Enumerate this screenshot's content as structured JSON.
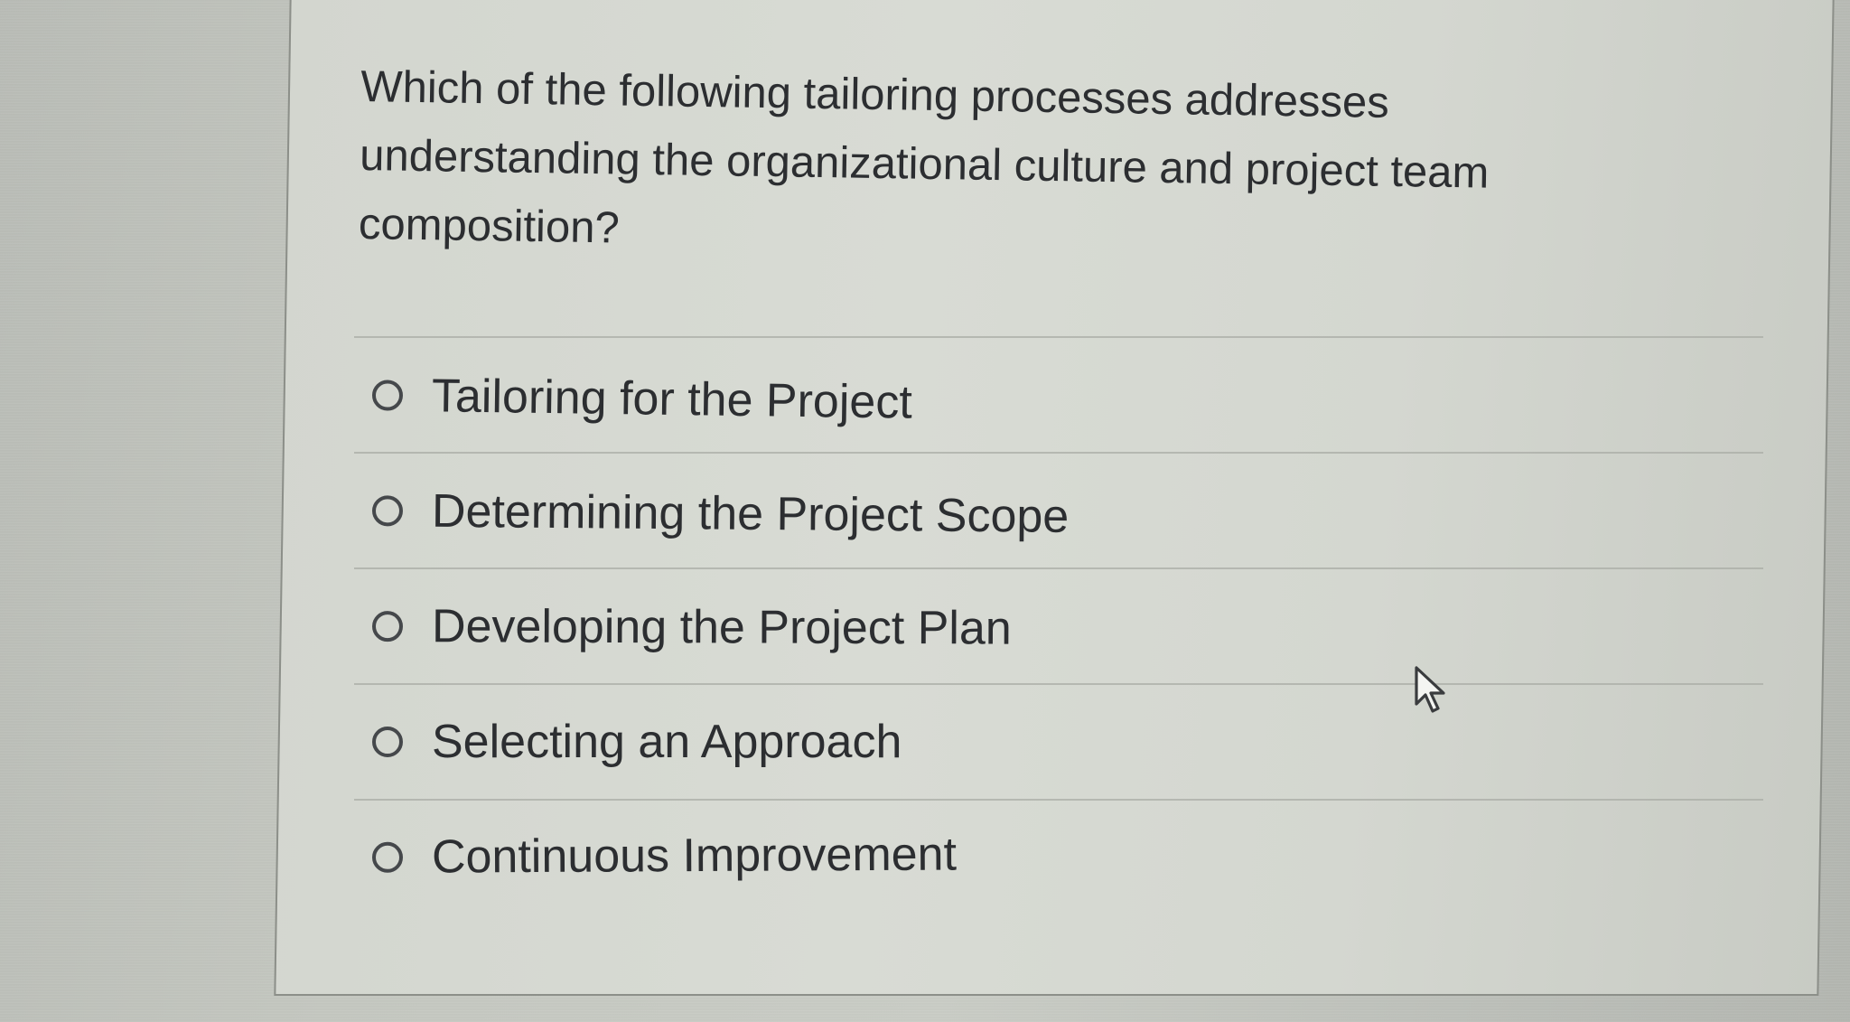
{
  "question": {
    "text": "Which of the following tailoring processes addresses understanding the organizational culture and project team composition?"
  },
  "options": [
    {
      "label": "Tailoring for the Project",
      "selected": false
    },
    {
      "label": "Determining the Project Scope",
      "selected": false
    },
    {
      "label": "Developing the Project Plan",
      "selected": false
    },
    {
      "label": "Selecting an Approach",
      "selected": false
    },
    {
      "label": "Continuous Improvement",
      "selected": false
    }
  ],
  "icons": {
    "option_radio": "radio-button-icon",
    "pointer": "mouse-pointer-icon"
  },
  "colors": {
    "text": "#2c2e31",
    "border": "#8c8f89",
    "divider": "#a9aca6"
  }
}
